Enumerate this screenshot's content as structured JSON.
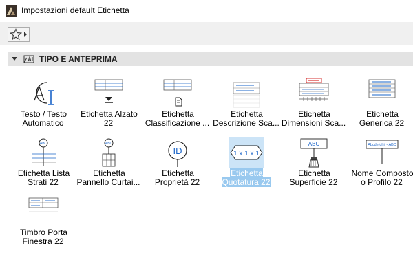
{
  "window": {
    "title": "Impostazioni default Etichetta"
  },
  "toolbar": {
    "favorites_icon": "star-icon",
    "caret_icon": "caret-right-icon"
  },
  "section": {
    "label": "TIPO E ANTEPRIMA",
    "icon": "label-preview-icon",
    "expanded": true
  },
  "items": [
    {
      "label": "Testo / Testo\nAutomatico",
      "icon": "text-auto-icon",
      "selected": false
    },
    {
      "label": "Etichetta Alzato\n22",
      "icon": "elevation-label-icon",
      "selected": false
    },
    {
      "label": "Etichetta\nClassificazione ...",
      "icon": "classification-label-icon",
      "selected": false
    },
    {
      "label": "Etichetta\nDescrizione Sca...",
      "icon": "description-label-icon",
      "selected": false
    },
    {
      "label": "Etichetta\nDimensioni Sca...",
      "icon": "dimension-label-icon",
      "selected": false
    },
    {
      "label": "Etichetta\nGenerica 22",
      "icon": "generic-label-icon",
      "selected": false
    },
    {
      "label": "Etichetta Lista\nStrati 22",
      "icon": "layer-list-label-icon",
      "selected": false
    },
    {
      "label": "Etichetta\nPannello Curtai...",
      "icon": "curtain-panel-label-icon",
      "selected": false
    },
    {
      "label": "Etichetta\nProprietà 22",
      "icon": "property-label-icon",
      "selected": false
    },
    {
      "label": "Etichetta\nQuotatura 22",
      "icon": "dimension-tag-icon",
      "selected": true
    },
    {
      "label": "Etichetta\nSuperficie 22",
      "icon": "surface-label-icon",
      "selected": false
    },
    {
      "label": "Nome Composto\no Profilo 22",
      "icon": "profile-name-label-icon",
      "selected": false
    },
    {
      "label": "Timbro Porta\nFinestra 22",
      "icon": "door-window-stamp-icon",
      "selected": false
    }
  ],
  "icon_text": {
    "abc": "ABC",
    "id": "ID",
    "dim_tag": "1 x 1 x 1",
    "abc_sm": "Abcdefghij - ABC"
  },
  "colors": {
    "accent": "#1a64c8",
    "selection": "#99c9ef"
  }
}
